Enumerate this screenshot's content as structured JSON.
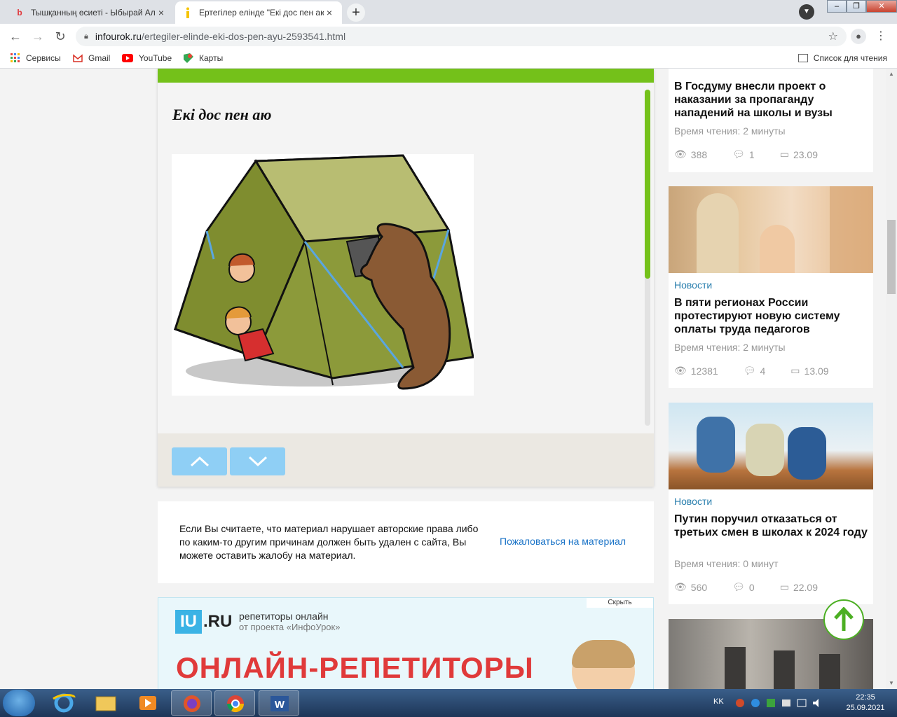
{
  "browser": {
    "tabs": [
      {
        "title": "Тышқанның өсиеті - Ыбырай Ал",
        "active": false
      },
      {
        "title": "Ертегілер елінде \"Екі дос пен аю",
        "active": true
      }
    ],
    "url_domain": "infourok.ru",
    "url_path": "/ertegiler-elinde-eki-dos-pen-ayu-2593541.html",
    "bookmarks": [
      "Сервисы",
      "Gmail",
      "YouTube",
      "Карты"
    ],
    "reading_list": "Список для чтения",
    "close_symbol": "×",
    "newtab_symbol": "+"
  },
  "viewer": {
    "doc_title": "Екі дос пен аю"
  },
  "report": {
    "text": "Если Вы считаете, что материал нарушает авторские права либо по каким-то другим причинам должен быть удален с сайта, Вы можете оставить жалобу на материал.",
    "link": "Пожаловаться на материал"
  },
  "ad": {
    "hide_label": "Скрыть",
    "logo_box": "IU",
    "logo_rest": ".RU",
    "tagline1": "репетиторы онлайн",
    "tagline2": "от проекта «ИнфоУрок»",
    "headline": "ОНЛАЙН-РЕПЕТИТОРЫ"
  },
  "sidebar": {
    "cards": [
      {
        "category": "",
        "headline": "В Госдуму внесли проект о наказании за пропаганду нападений на школы и вузы",
        "read_time": "Время чтения: 2 минуты",
        "views": "388",
        "comments": "1",
        "date": "23.09"
      },
      {
        "category": "Новости",
        "headline": "В пяти регионах России протестируют новую систему оплаты труда педагогов",
        "read_time": "Время чтения: 2 минуты",
        "views": "12381",
        "comments": "4",
        "date": "13.09"
      },
      {
        "category": "Новости",
        "headline": "Путин поручил отказаться от третьих смен в школах к 2024 году",
        "read_time": "Время чтения: 0 минут",
        "views": "560",
        "comments": "0",
        "date": "22.09"
      }
    ]
  },
  "taskbar": {
    "lang": "KK",
    "time": "22:35",
    "date": "25.09.2021"
  },
  "colors": {
    "accent_green": "#74c11a",
    "link_blue": "#1a73c7",
    "category_blue": "#2a7fae",
    "ad_red": "#e03a3a"
  }
}
